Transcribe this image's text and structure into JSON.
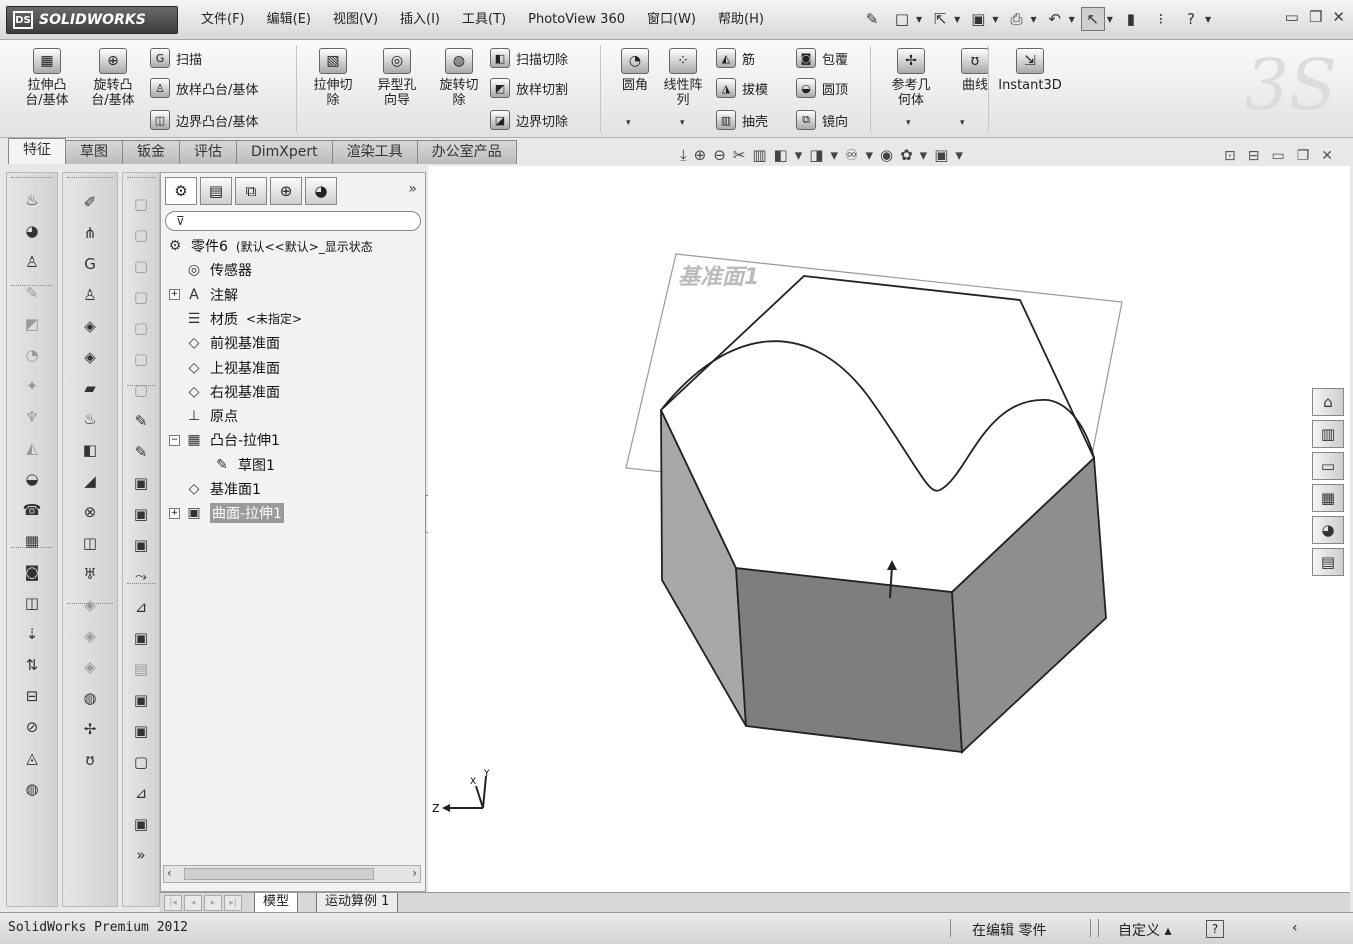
{
  "app": {
    "logo_text": "SOLIDWORKS",
    "logo_mark": "DS"
  },
  "menus": [
    "文件(F)",
    "编辑(E)",
    "视图(V)",
    "插入(I)",
    "工具(T)",
    "PhotoView 360",
    "窗口(W)",
    "帮助(H)"
  ],
  "quick_access": [
    {
      "name": "pin-icon",
      "glyph": "✎"
    },
    {
      "name": "new-document-icon",
      "glyph": "□"
    },
    {
      "name": "open-icon",
      "glyph": "⇱"
    },
    {
      "name": "save-icon",
      "glyph": "▣"
    },
    {
      "name": "print-icon",
      "glyph": "⎙"
    },
    {
      "name": "undo-icon",
      "glyph": "↶"
    },
    {
      "name": "select-icon",
      "glyph": "↖"
    },
    {
      "name": "rebuild-icon",
      "glyph": "▮"
    },
    {
      "name": "options-icon",
      "glyph": "⁝"
    },
    {
      "name": "help-icon",
      "glyph": "?"
    }
  ],
  "window_controls": [
    "▭",
    "❐",
    "✕"
  ],
  "ribbon": {
    "big": [
      {
        "name": "extrude-boss-button",
        "label": "拉伸凸\n台/基体",
        "glyph": "▦"
      },
      {
        "name": "revolve-boss-button",
        "label": "旋转凸\n台/基体",
        "glyph": "⊕"
      },
      {
        "name": "extrude-cut-button",
        "label": "拉伸切\n除",
        "glyph": "▧"
      },
      {
        "name": "hole-wizard-button",
        "label": "异型孔\n向导",
        "glyph": "◎"
      },
      {
        "name": "revolve-cut-button",
        "label": "旋转切\n除",
        "glyph": "◍"
      },
      {
        "name": "fillet-button",
        "label": "圆角",
        "glyph": "◔"
      },
      {
        "name": "linear-pattern-button",
        "label": "线性阵\n列",
        "glyph": "⁘"
      },
      {
        "name": "reference-geometry-button",
        "label": "参考几\n何体",
        "glyph": "✢"
      },
      {
        "name": "curves-button",
        "label": "曲线",
        "glyph": "ʊ"
      },
      {
        "name": "instant3d-button",
        "label": "Instant3D",
        "glyph": "⇲"
      }
    ],
    "small": [
      {
        "name": "sweep-button",
        "label": "扫描",
        "glyph": "G"
      },
      {
        "name": "loft-boss-button",
        "label": "放样凸台/基体",
        "glyph": "♙"
      },
      {
        "name": "boundary-boss-button",
        "label": "边界凸台/基体",
        "glyph": "◫"
      },
      {
        "name": "swept-cut-button",
        "label": "扫描切除",
        "glyph": "◧"
      },
      {
        "name": "lofted-cut-button",
        "label": "放样切割",
        "glyph": "◩"
      },
      {
        "name": "boundary-cut-button",
        "label": "边界切除",
        "glyph": "◪"
      },
      {
        "name": "rib-button",
        "label": "筋",
        "glyph": "◭"
      },
      {
        "name": "draft-button",
        "label": "拔模",
        "glyph": "◮"
      },
      {
        "name": "shell-button",
        "label": "抽壳",
        "glyph": "▥"
      },
      {
        "name": "wrap-button",
        "label": "包覆",
        "glyph": "◙"
      },
      {
        "name": "dome-button",
        "label": "圆顶",
        "glyph": "◒"
      },
      {
        "name": "mirror-button",
        "label": "镜向",
        "glyph": "⧉"
      }
    ]
  },
  "tabs": [
    "特征",
    "草图",
    "钣金",
    "评估",
    "DimXpert",
    "渲染工具",
    "办公室产品"
  ],
  "hud_icons": [
    "⤓",
    "⊕",
    "⊖",
    "✂",
    "▥",
    "◧",
    "◨",
    "♾",
    "◉",
    "✿",
    "▣"
  ],
  "view_controls": [
    "⊡",
    "⊟",
    "▭",
    "❐",
    "✕"
  ],
  "feature_tree": {
    "filter_glyph": "⊽",
    "more": "»",
    "rows": [
      {
        "level": 0,
        "exp": "",
        "glyph": "⚙",
        "label": "零件6",
        "suffix": "(默认<<默认>_显示状态",
        "hl": false,
        "name": "tree-part"
      },
      {
        "level": 1,
        "exp": "",
        "glyph": "◎",
        "label": "传感器",
        "suffix": "",
        "hl": false,
        "name": "tree-sensors"
      },
      {
        "level": 1,
        "exp": "+",
        "glyph": "A",
        "label": "注解",
        "suffix": "",
        "hl": false,
        "name": "tree-annotations"
      },
      {
        "level": 1,
        "exp": "",
        "glyph": "☰",
        "label": "材质",
        "suffix": "<未指定>",
        "hl": false,
        "name": "tree-material"
      },
      {
        "level": 1,
        "exp": "",
        "glyph": "◇",
        "label": "前视基准面",
        "suffix": "",
        "hl": false,
        "name": "tree-front-plane"
      },
      {
        "level": 1,
        "exp": "",
        "glyph": "◇",
        "label": "上视基准面",
        "suffix": "",
        "hl": false,
        "name": "tree-top-plane"
      },
      {
        "level": 1,
        "exp": "",
        "glyph": "◇",
        "label": "右视基准面",
        "suffix": "",
        "hl": false,
        "name": "tree-right-plane"
      },
      {
        "level": 1,
        "exp": "",
        "glyph": "⊥",
        "label": "原点",
        "suffix": "",
        "hl": false,
        "name": "tree-origin"
      },
      {
        "level": 1,
        "exp": "−",
        "glyph": "▦",
        "label": "凸台-拉伸1",
        "suffix": "",
        "hl": false,
        "name": "tree-boss-extrude1"
      },
      {
        "level": 2,
        "exp": "",
        "glyph": "✎",
        "label": "草图1",
        "suffix": "",
        "hl": false,
        "name": "tree-sketch1"
      },
      {
        "level": 1,
        "exp": "",
        "glyph": "◇",
        "label": "基准面1",
        "suffix": "",
        "hl": false,
        "name": "tree-plane1"
      },
      {
        "level": 1,
        "exp": "+",
        "glyph": "▣",
        "label": "曲面-拉伸1",
        "suffix": "",
        "hl": true,
        "name": "tree-surface-extrude1"
      }
    ]
  },
  "viewport": {
    "plane_label": "基准面1",
    "axis_z": "Z",
    "axis_y": "Y",
    "axis_x": "X"
  },
  "task_pane": [
    "⌂",
    "▥",
    "▭",
    "▦",
    "◕",
    "▤"
  ],
  "model_tabs": [
    "模型",
    "运动算例 1"
  ],
  "status": {
    "product": "SolidWorks Premium 2012",
    "editing": "在编辑 零件",
    "units": "自定义 ▴",
    "help": "?"
  }
}
